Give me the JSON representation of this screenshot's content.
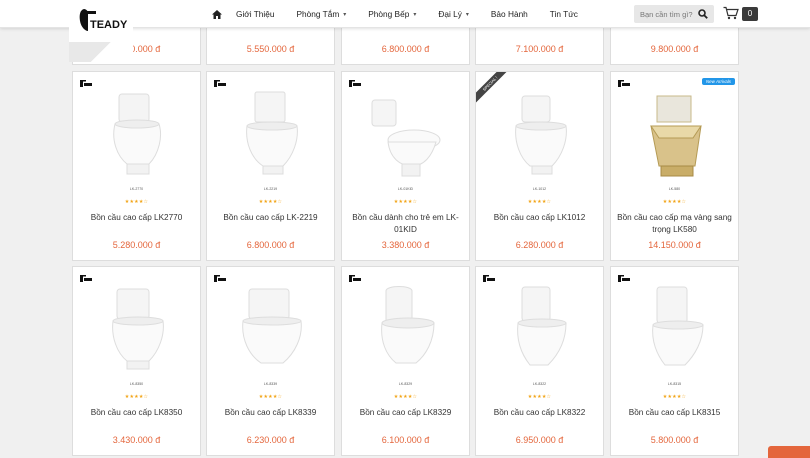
{
  "brand": {
    "name": "TEADY"
  },
  "nav": {
    "items": [
      {
        "label": "Giới Thiệu",
        "has_caret": false
      },
      {
        "label": "Phòng Tắm",
        "has_caret": true
      },
      {
        "label": "Phòng Bếp",
        "has_caret": true
      },
      {
        "label": "Đại Lý",
        "has_caret": true
      },
      {
        "label": "Bảo Hành",
        "has_caret": false
      },
      {
        "label": "Tin Tức",
        "has_caret": false
      }
    ]
  },
  "search": {
    "placeholder": "Bạn cần tìm gì?"
  },
  "cart": {
    "count": "0"
  },
  "top_row_prices": [
    "6.800.000 đ",
    "5.550.000 đ",
    "6.800.000 đ",
    "7.100.000 đ",
    "9.800.000 đ"
  ],
  "row1": [
    {
      "name": "Bồn cầu cao cấp LK2770",
      "code": "LK-2770",
      "price": "5.280.000 đ",
      "badge": ""
    },
    {
      "name": "Bồn cầu cao cấp LK-2219",
      "code": "LK-2219",
      "price": "6.800.000 đ",
      "badge": ""
    },
    {
      "name": "Bồn cầu dành cho trẻ em LK-01KID",
      "code": "LK-01KID",
      "price": "3.380.000 đ",
      "badge": ""
    },
    {
      "name": "Bồn cầu cao cấp LK1012",
      "code": "LK-1012",
      "price": "6.280.000 đ",
      "badge": "special"
    },
    {
      "name": "Bồn cầu cao cấp mạ vàng sang trọng LK580",
      "code": "LK-580",
      "price": "14.150.000 đ",
      "badge": "new"
    }
  ],
  "row2": [
    {
      "name": "Bồn cầu cao cấp LK8350",
      "code": "LK-8350",
      "price": "3.430.000 đ"
    },
    {
      "name": "Bồn cầu cao cấp LK8339",
      "code": "LK-8339",
      "price": "6.230.000 đ"
    },
    {
      "name": "Bồn cầu cao cấp LK8329",
      "code": "LK-8329",
      "price": "6.100.000 đ"
    },
    {
      "name": "Bồn cầu cao cấp LK8322",
      "code": "LK-8322",
      "price": "6.950.000 đ"
    },
    {
      "name": "Bồn cầu cao cấp LK8315",
      "code": "LK-8315",
      "price": "5.800.000 đ"
    }
  ],
  "badges": {
    "special": "SPECIAL !",
    "new": "New Arrivals"
  },
  "stars": "★★★★☆",
  "colors": {
    "price": "#e4663c",
    "star": "#f2a416",
    "new_badge": "#2296e8"
  }
}
